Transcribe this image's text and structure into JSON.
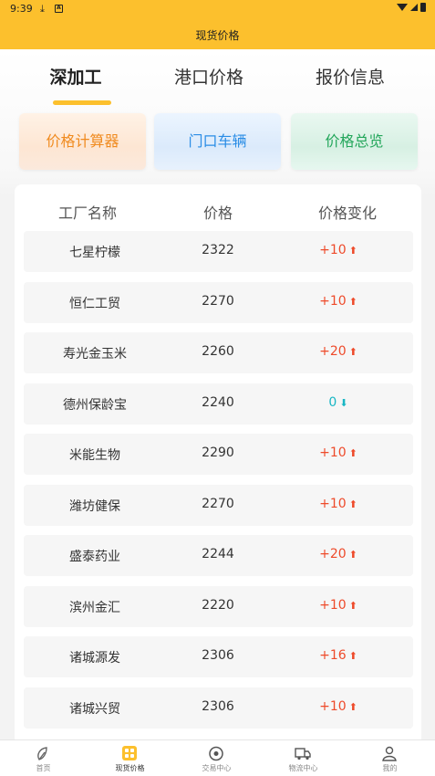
{
  "status_bar": {
    "time": "9:39",
    "icons": [
      "download-icon",
      "a-icon",
      "wifi-icon",
      "signal-icon",
      "battery-icon"
    ]
  },
  "header": {
    "title": "现货价格"
  },
  "tabs": [
    {
      "label": "深加工",
      "active": true
    },
    {
      "label": "港口价格",
      "active": false
    },
    {
      "label": "报价信息",
      "active": false
    }
  ],
  "feature_cards": [
    {
      "label": "价格计算器",
      "color": "#f08a1e"
    },
    {
      "label": "门口车辆",
      "color": "#2a8de6"
    },
    {
      "label": "价格总览",
      "color": "#22a65a"
    }
  ],
  "table": {
    "columns": [
      "工厂名称",
      "价格",
      "价格变化"
    ],
    "rows": [
      {
        "name": "七星柠檬",
        "price": "2322",
        "change": "+10",
        "direction": "up"
      },
      {
        "name": "恒仁工贸",
        "price": "2270",
        "change": "+10",
        "direction": "up"
      },
      {
        "name": "寿光金玉米",
        "price": "2260",
        "change": "+20",
        "direction": "up"
      },
      {
        "name": "德州保龄宝",
        "price": "2240",
        "change": "0",
        "direction": "flat"
      },
      {
        "name": "米能生物",
        "price": "2290",
        "change": "+10",
        "direction": "up"
      },
      {
        "name": "潍坊健保",
        "price": "2270",
        "change": "+10",
        "direction": "up"
      },
      {
        "name": "盛泰药业",
        "price": "2244",
        "change": "+20",
        "direction": "up"
      },
      {
        "name": "滨州金汇",
        "price": "2220",
        "change": "+10",
        "direction": "up"
      },
      {
        "name": "诸城源发",
        "price": "2306",
        "change": "+16",
        "direction": "up"
      },
      {
        "name": "诸城兴贸",
        "price": "2306",
        "change": "+10",
        "direction": "up"
      }
    ]
  },
  "tab_bar": [
    {
      "label": "首页",
      "icon": "home-icon",
      "active": false
    },
    {
      "label": "现货价格",
      "icon": "price-icon",
      "active": true
    },
    {
      "label": "交易中心",
      "icon": "trade-icon",
      "active": false
    },
    {
      "label": "物流中心",
      "icon": "truck-icon",
      "active": false
    },
    {
      "label": "我的",
      "icon": "user-icon",
      "active": false
    }
  ],
  "colors": {
    "accent": "#fcc02d",
    "up": "#ee4a2a",
    "flat": "#18b6c4"
  }
}
